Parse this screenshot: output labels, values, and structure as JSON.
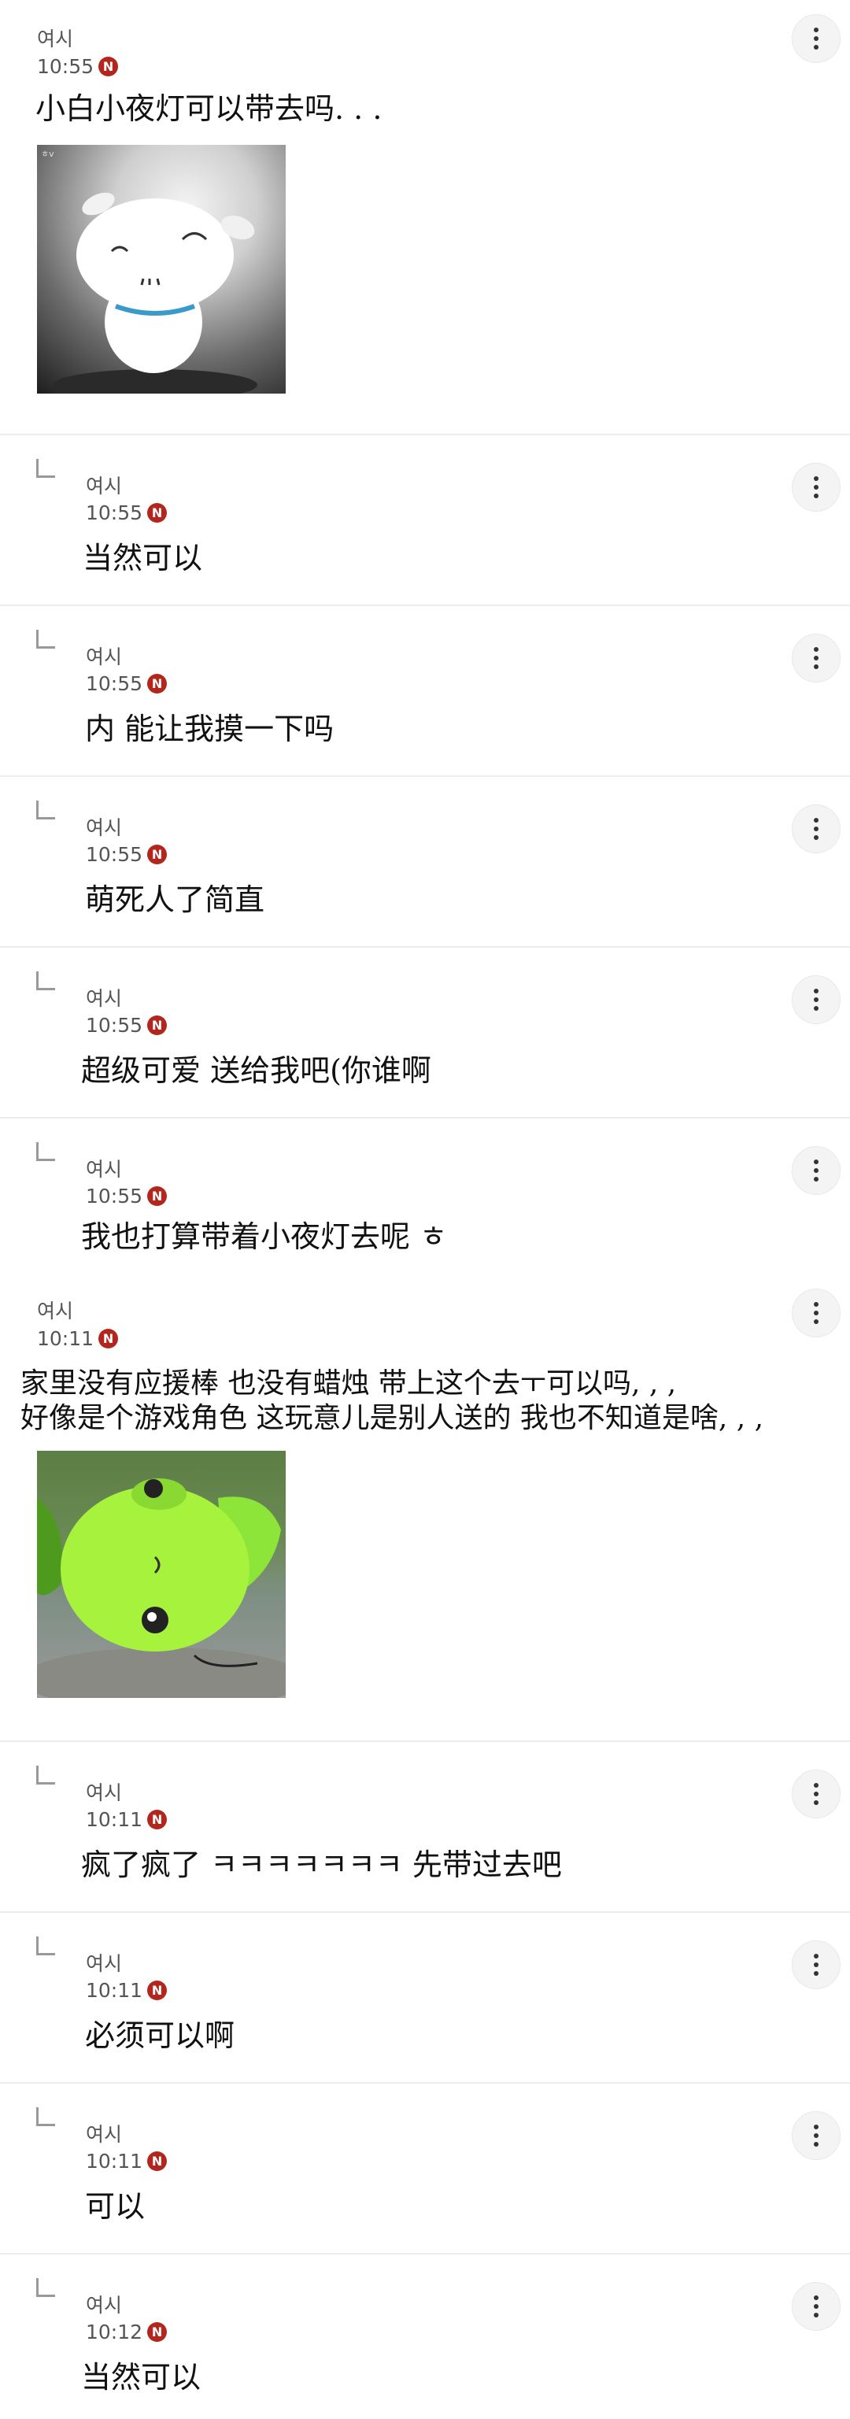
{
  "comments": [
    {
      "author": "여시",
      "time": "10:55",
      "badge": "N",
      "text": "小白小夜灯可以带去吗. . ."
    },
    {
      "author": "여시",
      "time": "10:55",
      "badge": "N",
      "text": "当然可以"
    },
    {
      "author": "여시",
      "time": "10:55",
      "badge": "N",
      "text": "内  能让我摸一下吗"
    },
    {
      "author": "여시",
      "time": "10:55",
      "badge": "N",
      "text": "萌死人了简直"
    },
    {
      "author": "여시",
      "time": "10:55",
      "badge": "N",
      "text": "超级可爱  送给我吧(你谁啊"
    },
    {
      "author": "여시",
      "time": "10:55",
      "badge": "N",
      "text": "我也打算带着小夜灯去呢  ㅎ"
    },
    {
      "author": "여시",
      "time": "10:11",
      "badge": "N",
      "line1": "家里没有应援棒  也没有蜡烛  带上这个去ㅜ可以吗, , ,",
      "line2": "好像是个游戏角色  这玩意儿是别人送的  我也不知道是啥, , ,"
    },
    {
      "author": "여시",
      "time": "10:11",
      "badge": "N",
      "text": "疯了疯了  ㅋㅋㅋㅋㅋㅋㅋ  先带过去吧"
    },
    {
      "author": "여시",
      "time": "10:11",
      "badge": "N",
      "text": "必须可以啊"
    },
    {
      "author": "여시",
      "time": "10:11",
      "badge": "N",
      "text": "可以"
    },
    {
      "author": "여시",
      "time": "10:12",
      "badge": "N",
      "text": "当然可以"
    }
  ],
  "image_watermark": "ㅎv"
}
